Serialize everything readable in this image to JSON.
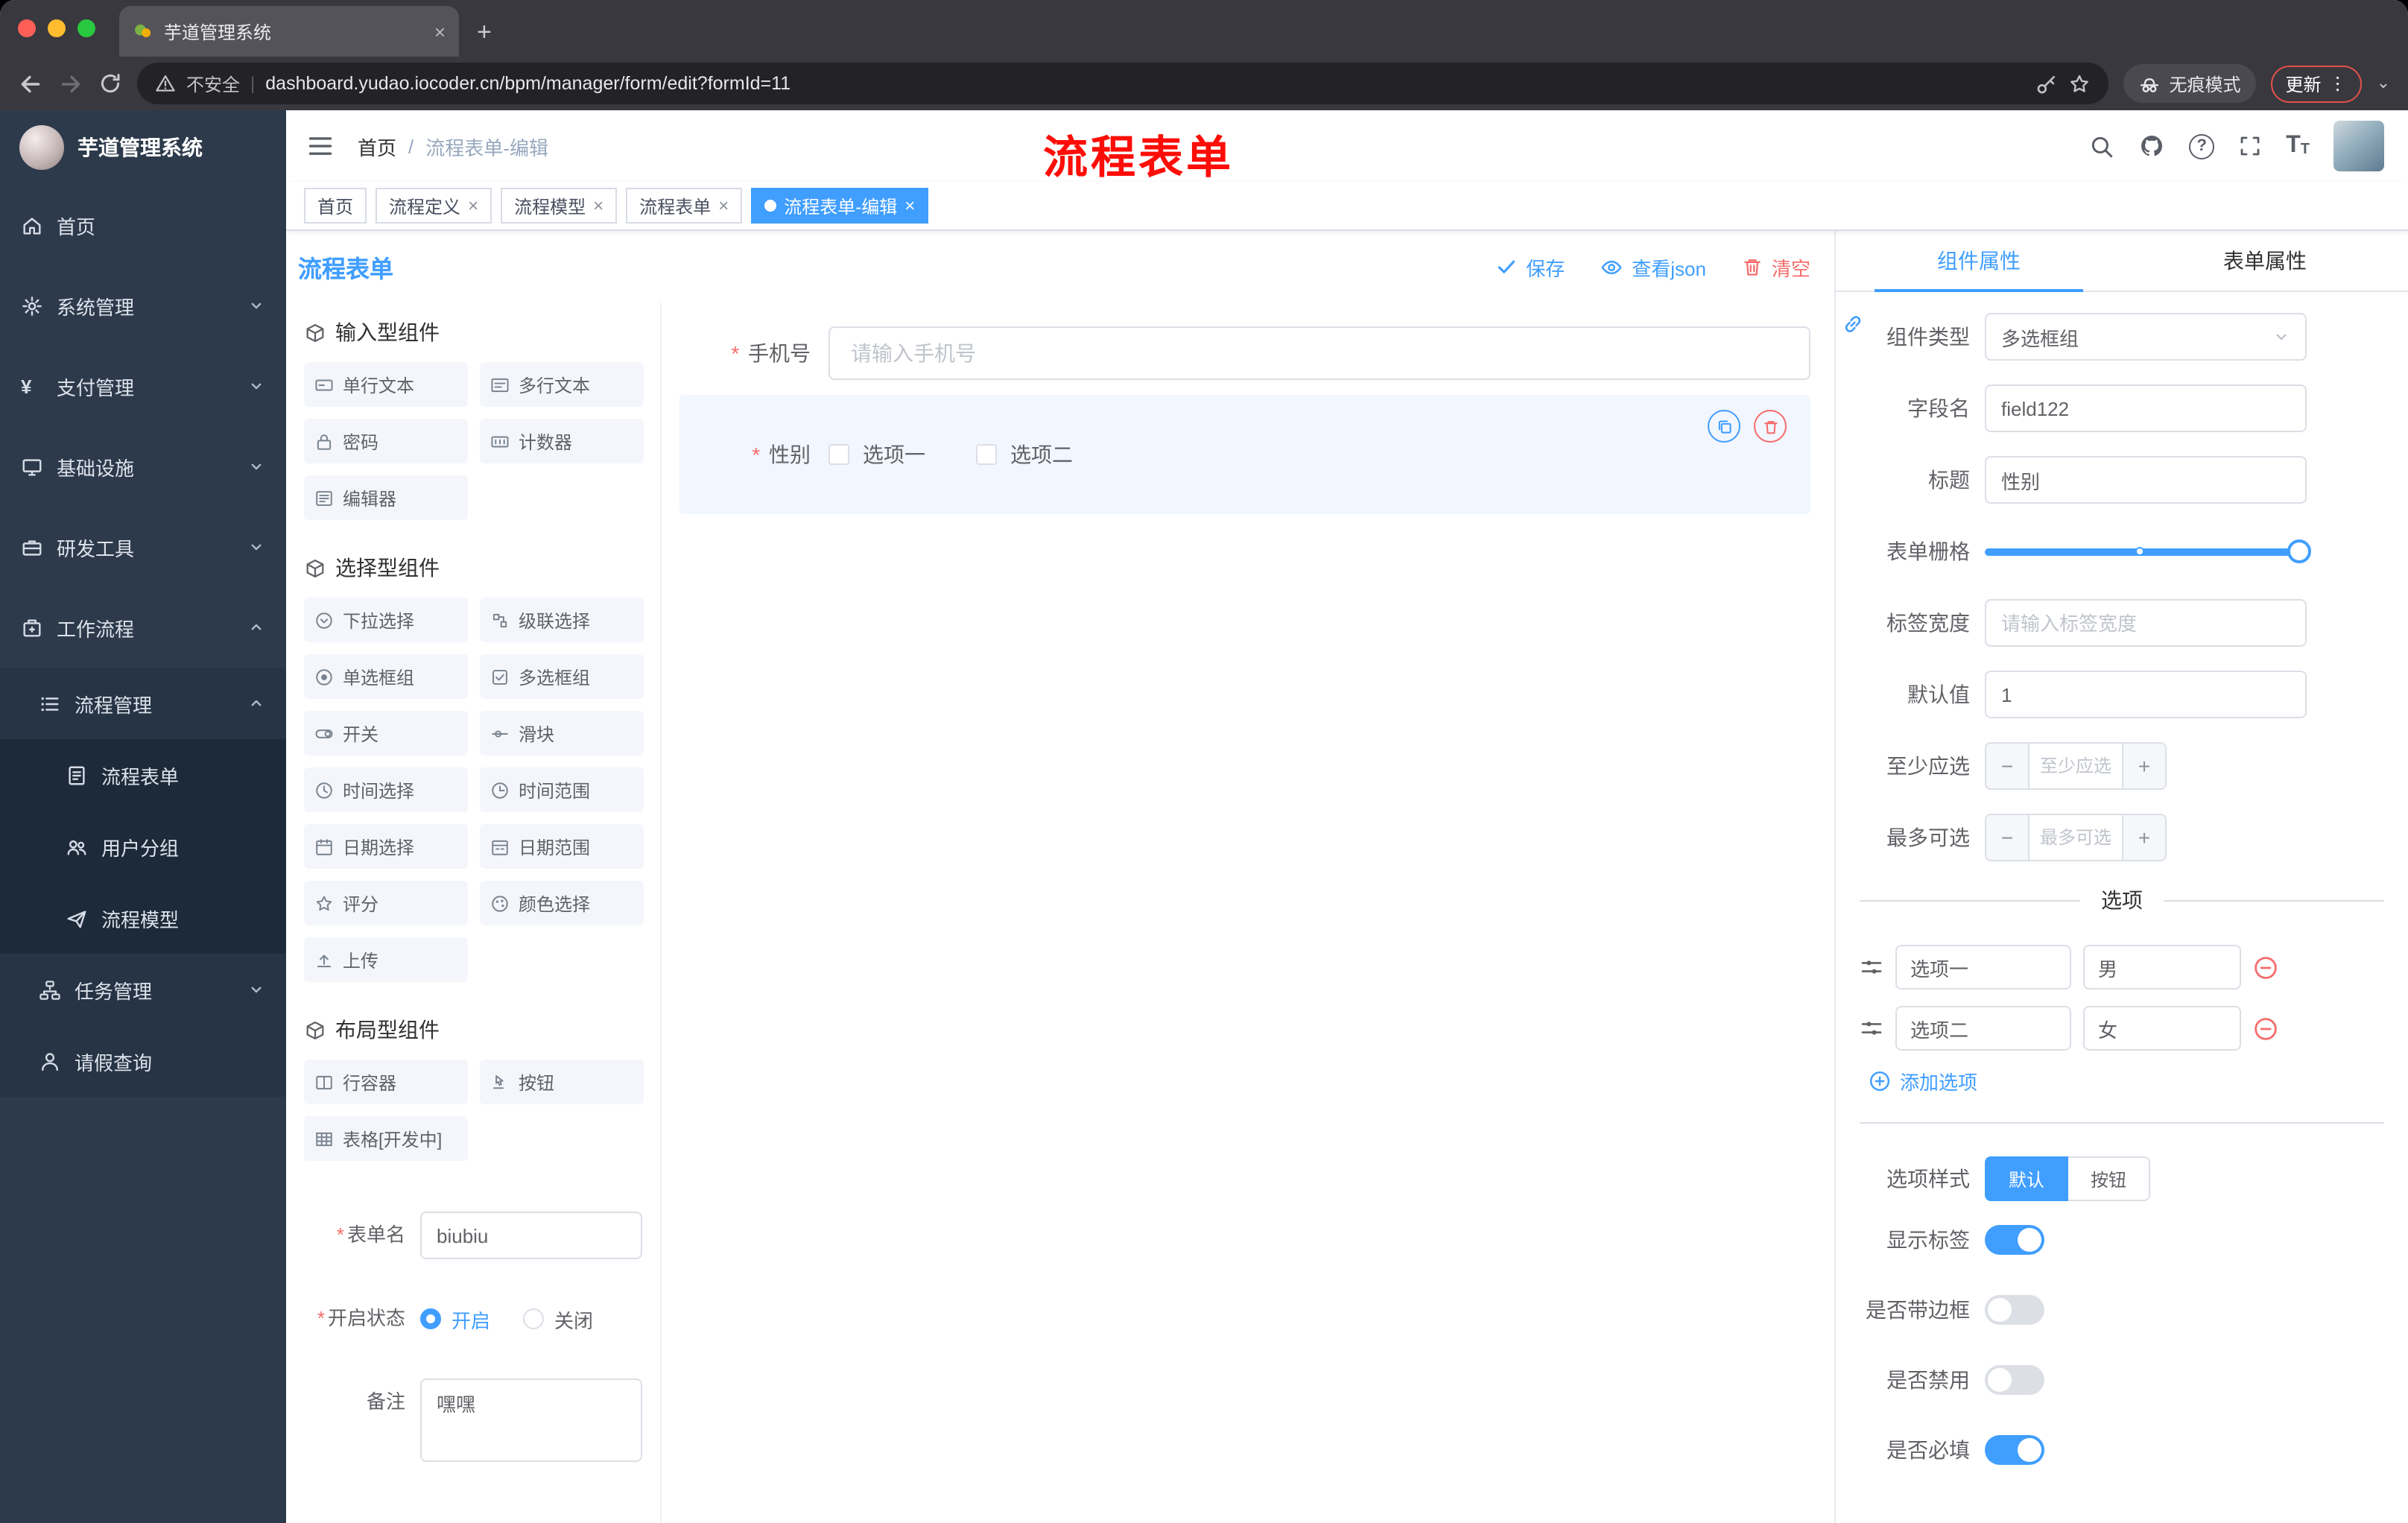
{
  "glyphs": {
    "close": "×",
    "plus": "+",
    "dots": "⋮",
    "caret": "⌄",
    "slash": "/",
    "asterisk": "*",
    "question": "?",
    "t_big": "T",
    "t_small": "T",
    "yen": "¥",
    "minus": "−",
    "pipe": "|"
  },
  "colors": {
    "accent": "#409eff",
    "danger": "#f56c6c",
    "sidebar": "#2d3a4b",
    "annotation": "#fd0d07"
  },
  "browser": {
    "tab_title": "芋道管理系统",
    "security_label": "不安全",
    "url": "dashboard.yudao.iocoder.cn/bpm/manager/form/edit?formId=11",
    "incognito_label": "无痕模式",
    "update_label": "更新"
  },
  "sidebar": {
    "logo_title": "芋道管理系统",
    "items": [
      {
        "label": "首页"
      },
      {
        "label": "系统管理"
      },
      {
        "label": "支付管理"
      },
      {
        "label": "基础设施"
      },
      {
        "label": "研发工具"
      },
      {
        "label": "工作流程"
      },
      {
        "label": "流程管理"
      },
      {
        "label": "流程表单"
      },
      {
        "label": "用户分组"
      },
      {
        "label": "流程模型"
      },
      {
        "label": "任务管理"
      },
      {
        "label": "请假查询"
      }
    ]
  },
  "header": {
    "breadcrumb": {
      "home": "首页",
      "current": "流程表单-编辑"
    },
    "annotation": "流程表单"
  },
  "tags": [
    {
      "label": "首页"
    },
    {
      "label": "流程定义"
    },
    {
      "label": "流程模型"
    },
    {
      "label": "流程表单"
    },
    {
      "label": "流程表单-编辑"
    }
  ],
  "designer": {
    "title": "流程表单",
    "actions": {
      "save": "保存",
      "view_json": "查看json",
      "clear": "清空"
    },
    "palette": {
      "sections": [
        {
          "title": "输入型组件",
          "items": [
            "单行文本",
            "多行文本",
            "密码",
            "计数器",
            "编辑器"
          ]
        },
        {
          "title": "选择型组件",
          "items": [
            "下拉选择",
            "级联选择",
            "单选框组",
            "多选框组",
            "开关",
            "滑块",
            "时间选择",
            "时间范围",
            "日期选择",
            "日期范围",
            "评分",
            "颜色选择",
            "上传"
          ]
        },
        {
          "title": "布局型组件",
          "items": [
            "行容器",
            "按钮",
            "表格[开发中]"
          ]
        }
      ]
    },
    "meta": {
      "name_label": "表单名",
      "name_value": "biubiu",
      "status_label": "开启状态",
      "status_on": "开启",
      "status_off": "关闭",
      "remark_label": "备注",
      "remark_value": "嘿嘿"
    },
    "canvas": {
      "phone": {
        "label": "手机号",
        "placeholder": "请输入手机号"
      },
      "gender": {
        "label": "性别",
        "option1": "选项一",
        "option2": "选项二"
      }
    }
  },
  "props": {
    "tab_component": "组件属性",
    "tab_form": "表单属性",
    "component_type_label": "组件类型",
    "component_type_value": "多选框组",
    "field_name_label": "字段名",
    "field_name_value": "field122",
    "title_label": "标题",
    "title_value": "性别",
    "grid_label": "表单栅格",
    "label_width_label": "标签宽度",
    "label_width_placeholder": "请输入标签宽度",
    "default_label": "默认值",
    "default_value": "1",
    "min_label": "至少应选",
    "min_placeholder": "至少应选",
    "max_label": "最多可选",
    "max_placeholder": "最多可选",
    "options_title": "选项",
    "options": [
      {
        "label": "选项一",
        "value": "男"
      },
      {
        "label": "选项二",
        "value": "女"
      }
    ],
    "add_option_label": "添加选项",
    "style_label": "选项样式",
    "style_default": "默认",
    "style_button": "按钮",
    "toggle_show_label": "显示标签",
    "toggle_border": "是否带边框",
    "toggle_disabled": "是否禁用",
    "toggle_required": "是否必填"
  }
}
